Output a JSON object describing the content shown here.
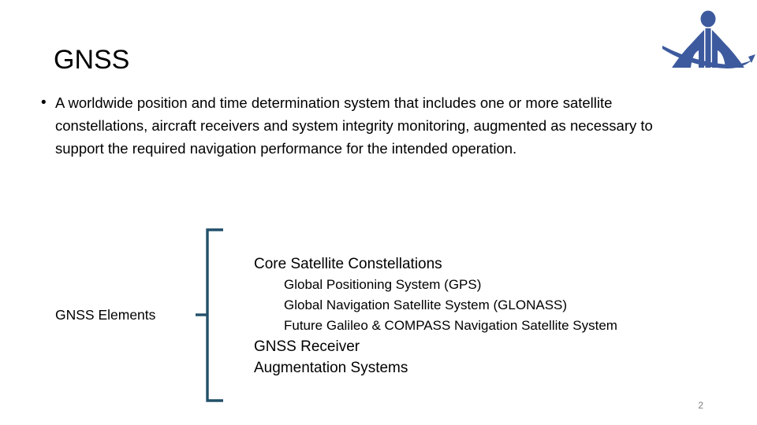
{
  "slide": {
    "title": "GNSS",
    "page_number": "2",
    "logo_icon": "aviation-authority-logo-icon",
    "logo_color": "#3d5a9e",
    "brace_color": "#22506a",
    "page_number_color": "#808080"
  },
  "body": {
    "bullet_marker": "•",
    "bullet_text": "A worldwide position and time determination system that includes one or more satellite constellations, aircraft receivers and system integrity monitoring, augmented as necessary to support the required navigation performance for the intended operation."
  },
  "diagram": {
    "brace_label": "GNSS Elements",
    "brace_icon": "curly-brace-icon",
    "elements": [
      {
        "level": 1,
        "label": "Core Satellite Constellations"
      },
      {
        "level": 2,
        "label": "Global Positioning System (GPS)"
      },
      {
        "level": 2,
        "label": "Global Navigation Satellite System (GLONASS)"
      },
      {
        "level": 2,
        "label": "Future Galileo & COMPASS Navigation Satellite System"
      },
      {
        "level": 1,
        "label": "GNSS Receiver"
      },
      {
        "level": 1,
        "label": "Augmentation Systems"
      }
    ]
  }
}
